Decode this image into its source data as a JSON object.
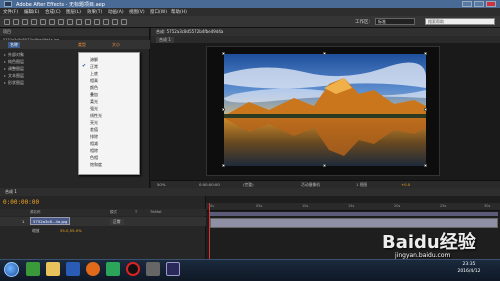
{
  "window": {
    "title": "Adobe After Effects - 无标题项目.aep"
  },
  "menu": [
    "文件(F)",
    "编辑(E)",
    "合成(C)",
    "图层(L)",
    "效果(T)",
    "动画(A)",
    "视图(V)",
    "窗口(W)",
    "帮助(H)"
  ],
  "toolbar": {
    "workspace_label": "工作区:",
    "workspace_value": "标准",
    "search_placeholder": "搜索帮助"
  },
  "project": {
    "tab": "项目",
    "file_name": "5752a3c8d5572b4fbe49d4a.jpg",
    "file_info": "1920 x 1080 (1.00) 数百万种颜色",
    "header": [
      "名称",
      "类型",
      "大小"
    ],
    "tree": [
      {
        "label": "外部对象"
      },
      {
        "label": "纯色图层"
      },
      {
        "label": "调整图层"
      },
      {
        "label": "文本图层"
      },
      {
        "label": "形状图层"
      }
    ]
  },
  "blend_menu": {
    "checked_index": 1,
    "items": [
      "溶解",
      "正常",
      "上底",
      "相乘",
      "颜色",
      "叠加",
      "柔光",
      "强光",
      "线性光",
      "亮光",
      "差值",
      "排除",
      "相减",
      "相除",
      "色相",
      "饱和度"
    ]
  },
  "composition": {
    "tab": "合成: 5752a3c8d5572b4fbe49d4a",
    "subtab": "合成 1"
  },
  "viewer_bar": {
    "zoom": "50%",
    "timecode": "0:00:00:00",
    "resolution": "(完整)",
    "camera": "活动摄像机",
    "views": "1 视图",
    "exposure": "+0.0"
  },
  "timeline": {
    "tab": "合成 1",
    "timecode": "0:00:00:00",
    "columns": [
      "源名称",
      "模式",
      "T",
      "TrkMat"
    ],
    "layer": {
      "index": "1",
      "name": "5752a3c8...4a.jpg",
      "mode": "正常",
      "effect_label": "缩放",
      "scale_value": "55.0,55.0%"
    },
    "ruler_ticks": [
      "0s",
      "05s",
      "10s",
      "15s",
      "20s",
      "25s",
      "30s"
    ]
  },
  "taskbar": {
    "time": "23:35",
    "date": "2016/4/12",
    "apps": [
      "chrome-icon",
      "folder-icon",
      "word-icon",
      "firefox-icon",
      "media-player-icon",
      "record-icon",
      "camera-icon",
      "after-effects-icon"
    ]
  },
  "watermark": {
    "text": "Baidu经验",
    "sub": "jingyan.baidu.com"
  },
  "colors": {
    "accent": "#f5a623",
    "selection": "#4a5a8a",
    "title_bar": "#4a6a96"
  }
}
